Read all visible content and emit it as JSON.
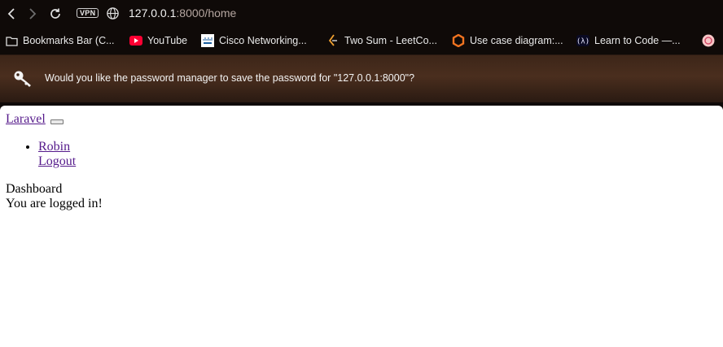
{
  "toolbar": {
    "vpn_label": "VPN",
    "url_host": "127.0.0.1",
    "url_rest": ":8000/home"
  },
  "bookmarks": [
    {
      "label": "Bookmarks Bar (C...",
      "icon": "folder-icon"
    },
    {
      "label": "YouTube",
      "icon": "youtube-icon"
    },
    {
      "label": "Cisco Networking...",
      "icon": "cisco-icon"
    },
    {
      "label": "Two Sum - LeetCo...",
      "icon": "leetcode-icon"
    },
    {
      "label": "Use case diagram:...",
      "icon": "diagram-icon"
    },
    {
      "label": "Learn to Code —...",
      "icon": "freecodecamp-icon"
    }
  ],
  "infobar": {
    "message": "Would you like the password manager to save the password for \"127.0.0.1:8000\"?"
  },
  "page": {
    "brand": "Laravel",
    "user_name": "Robin",
    "logout": "Logout",
    "card_header": "Dashboard",
    "card_body": "You are logged in!"
  }
}
